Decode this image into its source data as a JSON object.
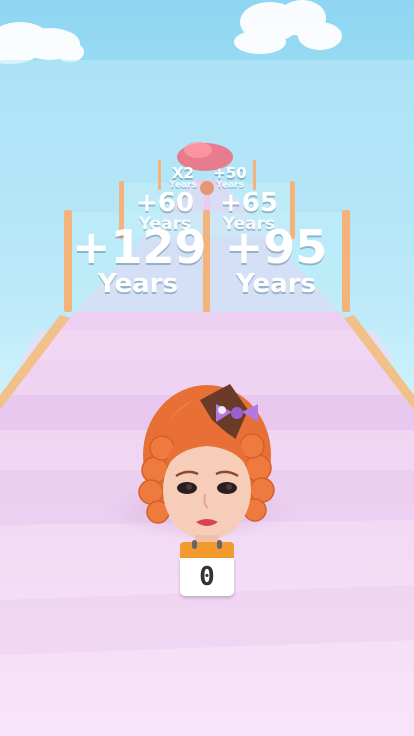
{
  "gates": {
    "near_left": {
      "value": "+129",
      "unit": "Years"
    },
    "near_right": {
      "value": "+95",
      "unit": "Years"
    },
    "mid_left": {
      "value": "+60",
      "unit": "Years"
    },
    "mid_right": {
      "value": "+65",
      "unit": "Years"
    },
    "far_left": {
      "value": "X2",
      "unit": "Years"
    },
    "far_right": {
      "value": "+50",
      "unit": "Years"
    }
  },
  "player": {
    "age_counter": "0"
  },
  "colors": {
    "sky": "#a9e3f7",
    "track": "#f1d6f3",
    "hair": "#ee7a3e",
    "bow": "#b07ae0",
    "calendar_top": "#f29a2e"
  },
  "icons": [
    "cloud-icon",
    "calendar-icon",
    "bow-icon"
  ]
}
